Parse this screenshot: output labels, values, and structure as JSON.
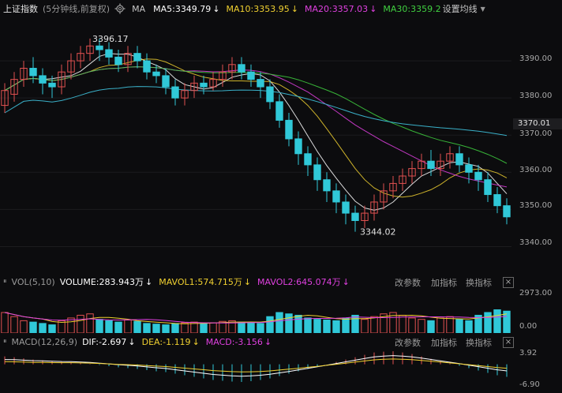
{
  "header": {
    "title": "上证指数",
    "subtitle": "(5分钟线,前复权)",
    "ma_label": "MA",
    "ma5": "MA5:3349.79",
    "ma10": "MA10:3353.95",
    "ma20": "MA20:3357.03",
    "ma30": "MA30:3359.2",
    "settings": "设置均线",
    "colors": {
      "ma5": "#ffffff",
      "ma10": "#f0d030",
      "ma20": "#e040e0",
      "ma30": "#40d040"
    }
  },
  "price_axis": {
    "ticks": [
      "3390.00",
      "3380.00",
      "3370.00",
      "3360.00",
      "3350.00",
      "3340.00"
    ],
    "last": "3370.01"
  },
  "annotations": {
    "high": "3396.17",
    "low": "3344.02"
  },
  "volume": {
    "label": "VOL(5,10)",
    "volume": "VOLUME:283.943万",
    "mavol1": "MAVOL1:574.715万",
    "mavol2": "MAVOL2:645.074万",
    "change_params": "改参数",
    "add_indicator": "加指标",
    "switch_indicator": "换指标",
    "axis_top": "2973.00",
    "axis_bottom": "0.00"
  },
  "macd": {
    "label": "MACD(12,26,9)",
    "dif": "DIF:-2.697",
    "dea": "DEA:-1.119",
    "macd": "MACD:-3.156",
    "change_params": "改参数",
    "add_indicator": "加指标",
    "switch_indicator": "换指标",
    "axis_top": "3.92",
    "axis_bottom": "-6.90"
  },
  "arrows": {
    "down": "↓"
  },
  "close_symbol": "×",
  "chart_data": {
    "type": "candlestick",
    "y_range": [
      3335,
      3400
    ],
    "candles": [
      [
        3378,
        3382,
        3376,
        3384
      ],
      [
        3381,
        3385,
        3379,
        3387
      ],
      [
        3385,
        3388,
        3383,
        3390
      ],
      [
        3388,
        3386,
        3384,
        3391
      ],
      [
        3386,
        3384,
        3381,
        3388
      ],
      [
        3384,
        3383,
        3380,
        3386
      ],
      [
        3383,
        3387,
        3381,
        3389
      ],
      [
        3387,
        3390,
        3385,
        3392
      ],
      [
        3390,
        3392,
        3388,
        3394
      ],
      [
        3392,
        3394,
        3390,
        3396
      ],
      [
        3394,
        3393,
        3390,
        3396
      ],
      [
        3393,
        3391,
        3389,
        3395
      ],
      [
        3391,
        3389,
        3387,
        3393
      ],
      [
        3389,
        3392,
        3387,
        3394
      ],
      [
        3392,
        3390,
        3388,
        3394
      ],
      [
        3390,
        3387,
        3385,
        3392
      ],
      [
        3387,
        3386,
        3384,
        3389
      ],
      [
        3386,
        3383,
        3381,
        3388
      ],
      [
        3383,
        3380,
        3378,
        3385
      ],
      [
        3380,
        3382,
        3378,
        3384
      ],
      [
        3382,
        3384,
        3380,
        3386
      ],
      [
        3384,
        3383,
        3381,
        3386
      ],
      [
        3383,
        3385,
        3382,
        3387
      ],
      [
        3385,
        3387,
        3383,
        3389
      ],
      [
        3387,
        3389,
        3385,
        3391
      ],
      [
        3389,
        3387,
        3385,
        3391
      ],
      [
        3387,
        3385,
        3383,
        3389
      ],
      [
        3385,
        3383,
        3380,
        3387
      ],
      [
        3383,
        3379,
        3377,
        3385
      ],
      [
        3379,
        3374,
        3372,
        3381
      ],
      [
        3374,
        3369,
        3367,
        3376
      ],
      [
        3369,
        3365,
        3362,
        3371
      ],
      [
        3365,
        3362,
        3359,
        3367
      ],
      [
        3362,
        3358,
        3355,
        3364
      ],
      [
        3358,
        3355,
        3352,
        3360
      ],
      [
        3355,
        3352,
        3349,
        3357
      ],
      [
        3352,
        3349,
        3346,
        3354
      ],
      [
        3349,
        3347,
        3344,
        3351
      ],
      [
        3347,
        3349,
        3345,
        3351
      ],
      [
        3349,
        3352,
        3347,
        3354
      ],
      [
        3352,
        3355,
        3350,
        3357
      ],
      [
        3355,
        3357,
        3353,
        3359
      ],
      [
        3357,
        3359,
        3355,
        3361
      ],
      [
        3359,
        3361,
        3357,
        3363
      ],
      [
        3361,
        3363,
        3359,
        3365
      ],
      [
        3363,
        3361,
        3359,
        3366
      ],
      [
        3361,
        3363,
        3359,
        3365
      ],
      [
        3363,
        3365,
        3361,
        3367
      ],
      [
        3365,
        3362,
        3360,
        3367
      ],
      [
        3362,
        3360,
        3357,
        3364
      ],
      [
        3360,
        3358,
        3355,
        3362
      ],
      [
        3358,
        3354,
        3352,
        3360
      ],
      [
        3354,
        3351,
        3349,
        3356
      ],
      [
        3351,
        3348,
        3346,
        3353
      ]
    ],
    "volume": [
      1500,
      1200,
      900,
      800,
      700,
      600,
      900,
      1100,
      1300,
      1400,
      1000,
      900,
      800,
      950,
      850,
      700,
      650,
      600,
      700,
      750,
      800,
      700,
      750,
      850,
      900,
      800,
      750,
      700,
      1200,
      1500,
      1400,
      1300,
      1100,
      1000,
      950,
      900,
      1100,
      1300,
      1000,
      1200,
      1400,
      1500,
      1300,
      1100,
      1000,
      900,
      1100,
      1200,
      1000,
      900,
      1300,
      1500,
      1700,
      1600
    ],
    "macd_hist": [
      2.0,
      1.8,
      1.5,
      1.2,
      1.0,
      0.8,
      0.6,
      0.5,
      0.3,
      0.1,
      -0.2,
      -0.5,
      -0.8,
      -1.0,
      -1.2,
      -1.5,
      -1.8,
      -2.0,
      -2.4,
      -2.8,
      -3.2,
      -3.6,
      -4.0,
      -4.2,
      -4.4,
      -4.5,
      -4.3,
      -4.0,
      -3.6,
      -3.0,
      -2.4,
      -1.8,
      -1.2,
      -0.6,
      0.0,
      0.6,
      1.2,
      1.8,
      2.4,
      3.0,
      3.2,
      3.3,
      3.0,
      2.6,
      2.0,
      1.4,
      0.8,
      0.2,
      -0.4,
      -1.0,
      -1.6,
      -2.2,
      -2.8,
      -3.2
    ]
  }
}
